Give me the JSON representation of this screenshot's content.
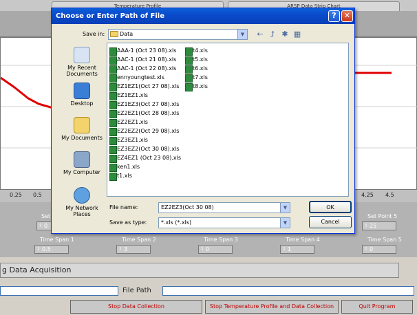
{
  "app": {
    "tabs": [
      "Temperature Profile",
      "ARSP Data Strip Chart"
    ],
    "x_ticks": [
      "0.25",
      "0.5",
      "4.25",
      "4.5"
    ],
    "set_points": {
      "label_left": "Set",
      "value_left": "0",
      "label_right": "Set Point 5",
      "value_right": "25"
    },
    "time_spans": [
      {
        "label": "Time Span 1",
        "value": "0.5"
      },
      {
        "label": "Time Span 2",
        "value": "3"
      },
      {
        "label": "Time Span 3",
        "value": "0"
      },
      {
        "label": "Time Span 4",
        "value": "1"
      },
      {
        "label": "Time Span 5",
        "value": "0"
      }
    ],
    "status_text": "g Data Acquisition",
    "file_path_label": "File Path",
    "buttons": [
      "Stop Data Collection",
      "Stop Temperature Profile and Data Collection",
      "Quit Program"
    ],
    "colors": {
      "trace": "#e00000",
      "button_text": "#c00000"
    }
  },
  "dialog": {
    "title": "Choose or Enter Path of File",
    "help_label": "?",
    "close_label": "✕",
    "save_in_label": "Save in:",
    "save_in_value": "Data",
    "places": [
      "My Recent Documents",
      "Desktop",
      "My Documents",
      "My Computer",
      "My Network Places"
    ],
    "files_col1": [
      "AAA-1 (Oct 23 08).xls",
      "AAC-1 (Oct 21 08).xls",
      "AAC-1 (Oct 22 08).xls",
      "ennyoungtest.xls",
      "EZ1EZ1(Oct 27 08).xls",
      "EZ1EZ1.xls",
      "EZ1EZ3(Oct 27 08).xls",
      "EZ2EZ1(Oct 28 08).xls",
      "EZ2EZ1.xls",
      "EZ2EZ2(Oct 29 08).xls",
      "EZ3EZ1.xls",
      "EZ3EZ2(Oct 30 08).xls",
      "EZ4EZ1 (Oct 23 08).xls",
      "ken1.xls",
      "t1.xls"
    ],
    "files_col2": [
      "t4.xls",
      "t5.xls",
      "t6.xls",
      "t7.xls",
      "t8.xls"
    ],
    "file_name_label": "File name:",
    "file_name_value": "EZ2EZ3(Oct 30 08)",
    "save_type_label": "Save as type:",
    "save_type_value": "*.xls (*.xls)",
    "ok_label": "OK",
    "cancel_label": "Cancel"
  }
}
